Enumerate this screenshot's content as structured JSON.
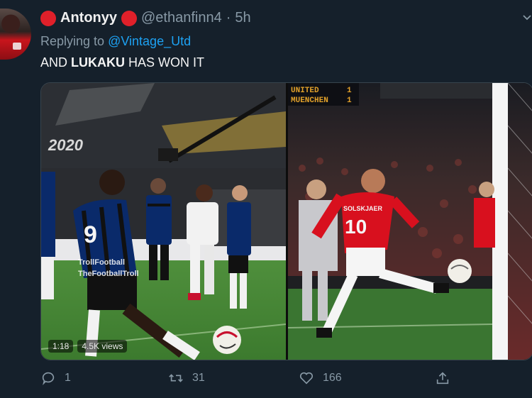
{
  "author": {
    "display_name": "Antonyy",
    "handle": "@ethanfinn4",
    "separator": "·",
    "time": "5h",
    "badge_color": "#e0202a"
  },
  "reply": {
    "prefix": "Replying to",
    "mention": "@Vintage_Utd"
  },
  "tweet": {
    "text_before": "AND ",
    "text_bold": "LUKAKU",
    "text_after": " HAS WON IT"
  },
  "media": {
    "left_scoreboard_year": "2020",
    "left_watermark_1": "TrollFootball",
    "left_watermark_2": "TheFootballTroll",
    "left_jersey_number": "9",
    "right_scoreboard_team_1": "UNITED",
    "right_scoreboard_team_2": "MUENCHEN",
    "right_score_1": "1",
    "right_score_2": "1",
    "right_jersey_number": "10",
    "right_jersey_name": "SOLSKJAER",
    "video_duration": "1:18",
    "video_views": "4.5K views"
  },
  "actions": {
    "reply_count": "1",
    "retweet_count": "31",
    "like_count": "166"
  },
  "colors": {
    "background": "#15202b",
    "accent": "#1da1f2",
    "muted": "#8899a6"
  }
}
